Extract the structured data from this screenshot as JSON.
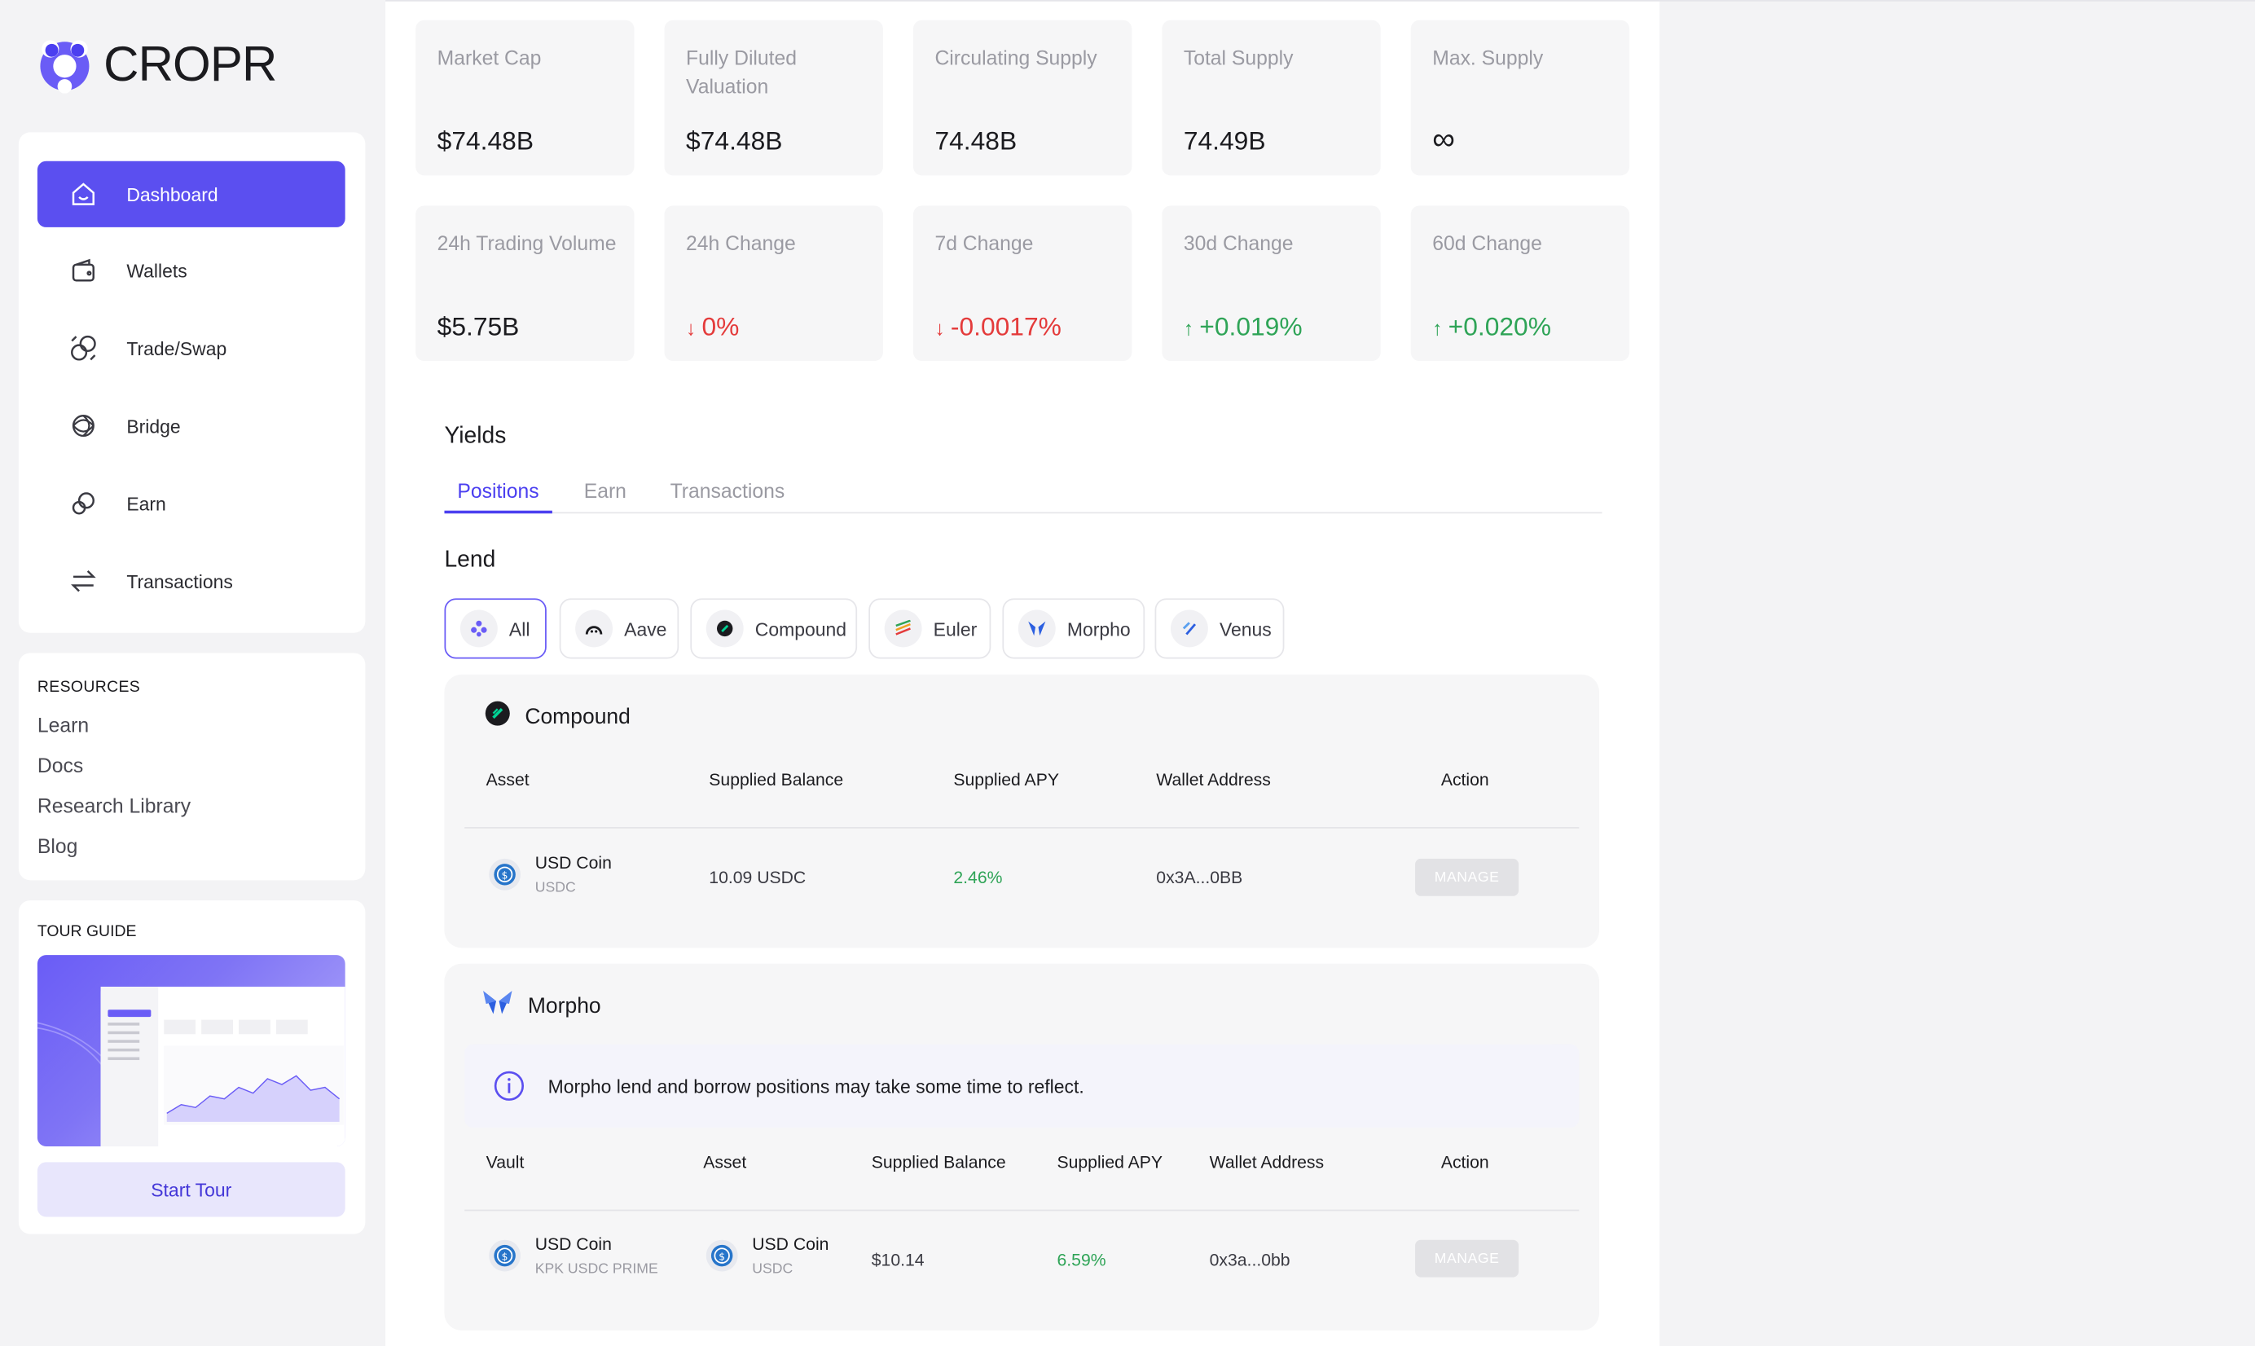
{
  "app": {
    "name": "CROPR"
  },
  "sidebar": {
    "items": [
      {
        "label": "Dashboard",
        "icon": "home-icon",
        "active": true
      },
      {
        "label": "Wallets",
        "icon": "wallet-icon"
      },
      {
        "label": "Trade/Swap",
        "icon": "swap-coins-icon"
      },
      {
        "label": "Bridge",
        "icon": "bridge-icon"
      },
      {
        "label": "Earn",
        "icon": "earn-icon"
      },
      {
        "label": "Transactions",
        "icon": "transfer-arrows-icon"
      }
    ],
    "resources": {
      "heading": "RESOURCES",
      "links": [
        "Learn",
        "Docs",
        "Research Library",
        "Blog"
      ]
    },
    "tour": {
      "heading": "TOUR GUIDE",
      "button": "Start Tour"
    }
  },
  "stats": [
    {
      "label": "Market Cap",
      "value": "$74.48B"
    },
    {
      "label": "Fully Diluted Valuation",
      "value": "$74.48B"
    },
    {
      "label": "Circulating Supply",
      "value": "74.48B"
    },
    {
      "label": "Total Supply",
      "value": "74.49B"
    },
    {
      "label": "Max. Supply",
      "value": "∞"
    },
    {
      "label": "24h Trading Volume",
      "value": "$5.75B"
    },
    {
      "label": "24h Change",
      "value": "0%",
      "trend": "down"
    },
    {
      "label": "7d Change",
      "value": "-0.0017%",
      "trend": "down"
    },
    {
      "label": "30d Change",
      "value": "+0.019%",
      "trend": "up"
    },
    {
      "label": "60d Change",
      "value": "+0.020%",
      "trend": "up"
    }
  ],
  "yields": {
    "title": "Yields",
    "tabs": [
      "Positions",
      "Earn",
      "Transactions"
    ],
    "active_tab": "Positions"
  },
  "lend": {
    "title": "Lend",
    "filters": [
      "All",
      "Aave",
      "Compound",
      "Euler",
      "Morpho",
      "Venus"
    ],
    "active_filter": "All"
  },
  "compound": {
    "title": "Compound",
    "columns": [
      "Asset",
      "Supplied Balance",
      "Supplied APY",
      "Wallet Address",
      "Action"
    ],
    "rows": [
      {
        "asset_name": "USD Coin",
        "asset_symbol": "USDC",
        "balance": "10.09 USDC",
        "apy": "2.46%",
        "wallet": "0x3A...0BB",
        "action": "MANAGE"
      }
    ]
  },
  "morpho": {
    "title": "Morpho",
    "notice": "Morpho lend and borrow positions may take some time to reflect.",
    "columns": [
      "Vault",
      "Asset",
      "Supplied Balance",
      "Supplied APY",
      "Wallet Address",
      "Action"
    ],
    "rows": [
      {
        "vault_name": "USD Coin",
        "vault_symbol": "KPK USDC PRIME",
        "asset_name": "USD Coin",
        "asset_symbol": "USDC",
        "balance": "$10.14",
        "apy": "6.59%",
        "wallet": "0x3a...0bb",
        "action": "MANAGE"
      }
    ]
  },
  "colors": {
    "accent": "#5b4ff0",
    "up": "#2fa457",
    "down": "#e43b3b"
  }
}
